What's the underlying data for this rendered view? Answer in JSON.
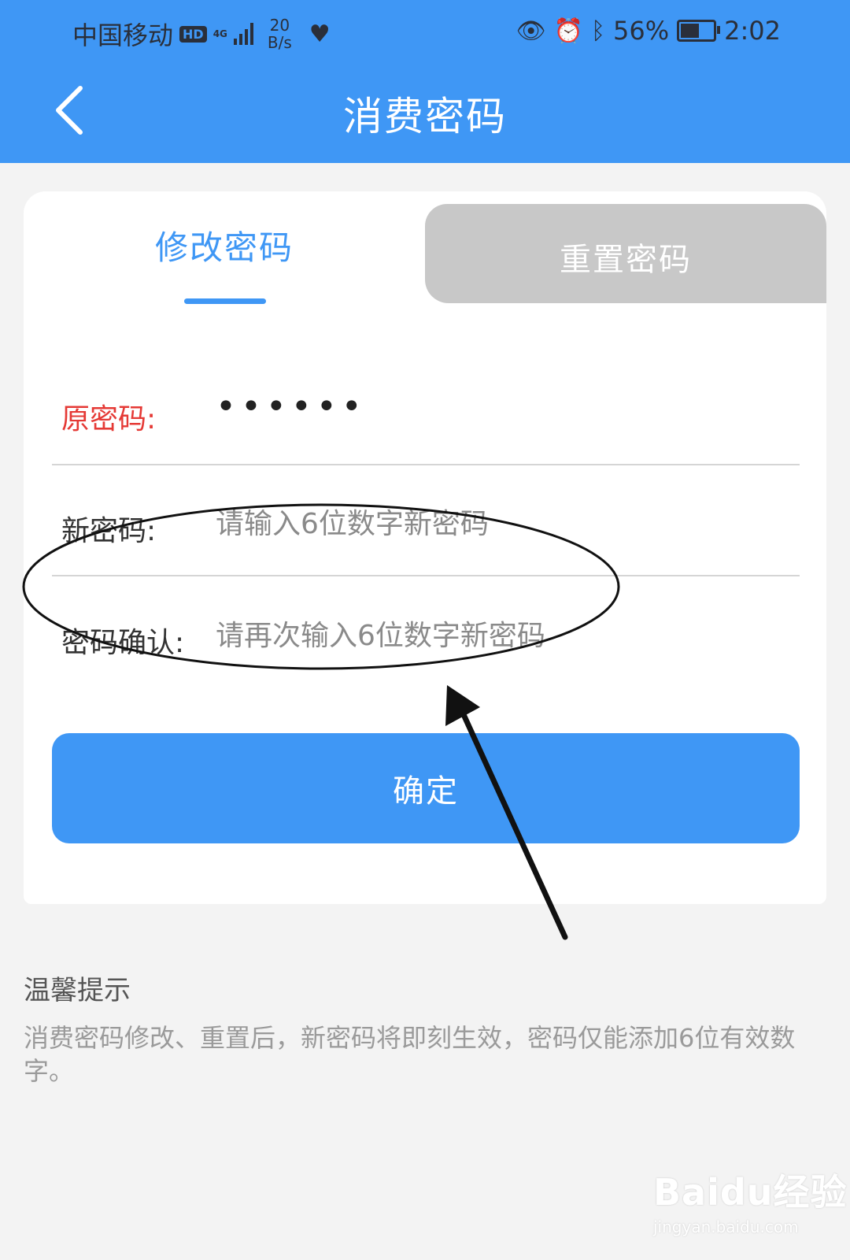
{
  "status_bar": {
    "carrier": "中国移动",
    "hd": "HD",
    "network": "4G",
    "speed_value": "20",
    "speed_unit": "B/s",
    "battery_percent": "56%",
    "battery_level": 0.56,
    "time": "2:02",
    "icons": [
      "eye-icon",
      "alarm-icon",
      "bluetooth-icon",
      "battery-icon"
    ]
  },
  "header": {
    "title": "消费密码",
    "back_icon": "chevron-left-icon"
  },
  "tabs": [
    {
      "label": "修改密码",
      "active": true
    },
    {
      "label": "重置密码",
      "active": false
    }
  ],
  "form": {
    "old_password": {
      "label": "原密码:",
      "value": "••••••"
    },
    "new_password": {
      "label": "新密码:",
      "placeholder": "请输入6位数字新密码"
    },
    "confirm_password": {
      "label": "密码确认:",
      "placeholder": "请再次输入6位数字新密码"
    }
  },
  "confirm_button": "确定",
  "tips": {
    "title": "温馨提示",
    "body": "消费密码修改、重置后，新密码将即刻生效，密码仅能添加6位有效数字。"
  },
  "watermark": {
    "logo": "Baidu经验",
    "url": "jingyan.baidu.com"
  },
  "colors": {
    "primary": "#3f97f5",
    "required": "#e53935",
    "inactive_tab": "#c8c8c8",
    "background": "#f3f3f3"
  }
}
